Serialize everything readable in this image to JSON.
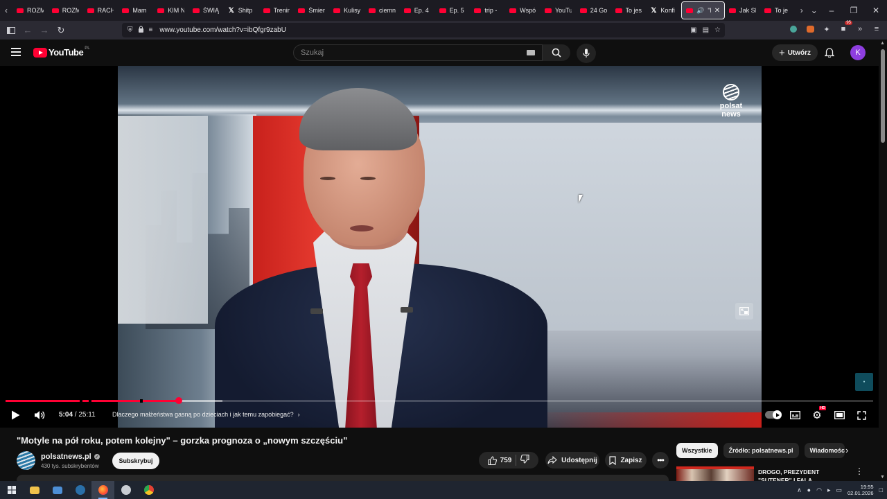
{
  "browser": {
    "tabs": [
      {
        "label": "ROZM",
        "icon": "youtube-icon"
      },
      {
        "label": "ROZM",
        "icon": "youtube-icon"
      },
      {
        "label": "RACH",
        "icon": "youtube-icon"
      },
      {
        "label": "Mam",
        "icon": "youtube-icon"
      },
      {
        "label": "KIM N",
        "icon": "youtube-icon"
      },
      {
        "label": "ŚWIĄ",
        "icon": "youtube-icon"
      },
      {
        "label": "Shitp",
        "icon": "x-icon"
      },
      {
        "label": "Trenin",
        "icon": "youtube-icon"
      },
      {
        "label": "Śmier",
        "icon": "youtube-icon"
      },
      {
        "label": "Kulisy",
        "icon": "youtube-icon"
      },
      {
        "label": "ciemn",
        "icon": "youtube-icon"
      },
      {
        "label": "Ep. 4",
        "icon": "youtube-icon"
      },
      {
        "label": "Ep. 5",
        "icon": "youtube-icon"
      },
      {
        "label": "trip -",
        "icon": "youtube-icon"
      },
      {
        "label": "Wspó",
        "icon": "youtube-icon"
      },
      {
        "label": "YouTu",
        "icon": "youtube-icon"
      },
      {
        "label": "24 Go",
        "icon": "youtube-icon"
      },
      {
        "label": "To jes",
        "icon": "youtube-icon"
      },
      {
        "label": "Konfi",
        "icon": "x-icon"
      }
    ],
    "active_tab": {
      "label": "\"M"
    },
    "tabs_after": [
      {
        "label": "Jak SI",
        "icon": "youtube-icon"
      },
      {
        "label": "To je",
        "icon": "youtube-icon"
      }
    ],
    "url": "www.youtube.com/watch?v=ibQfgr9zabU",
    "extension_badge": "95"
  },
  "youtube": {
    "logo_text": "YouTube",
    "country_code": "PL",
    "search_placeholder": "Szukaj",
    "create_label": "Utwórz",
    "avatar_letter": "K"
  },
  "player": {
    "current_time": "5:04",
    "duration": "25:11",
    "time_separator": "/",
    "chapter_title": "Dlaczego małżeństwa gasną po dzieciach i jak temu zapobiegać?",
    "overlay_logo_line1": "polsat",
    "overlay_logo_line2": "news",
    "played_fraction": 0.2,
    "buffered_fraction": 0.25,
    "hd_badge": "HD",
    "accent_color": "#ff0033"
  },
  "video": {
    "title": "\"Motyle na pół roku, potem kolejny\" – gorzka prognoza o „nowym szczęściu”",
    "channel_name": "polsatnews.pl",
    "subscribers": "430 tys. subskrybentów",
    "subscribe_label": "Subskrybuj",
    "likes": "759",
    "share_label": "Udostępnij",
    "save_label": "Zapisz"
  },
  "sidebar": {
    "chips": [
      "Wszystkie",
      "Źródło: polsatnews.pl",
      "Wiadomości"
    ],
    "recommendation_title": "DROGO, PREZYDENT \"SUTENER\" I FALA UKRAIŃCÓ..."
  },
  "taskbar": {
    "time": "19:55",
    "date": "02.01.2026"
  }
}
